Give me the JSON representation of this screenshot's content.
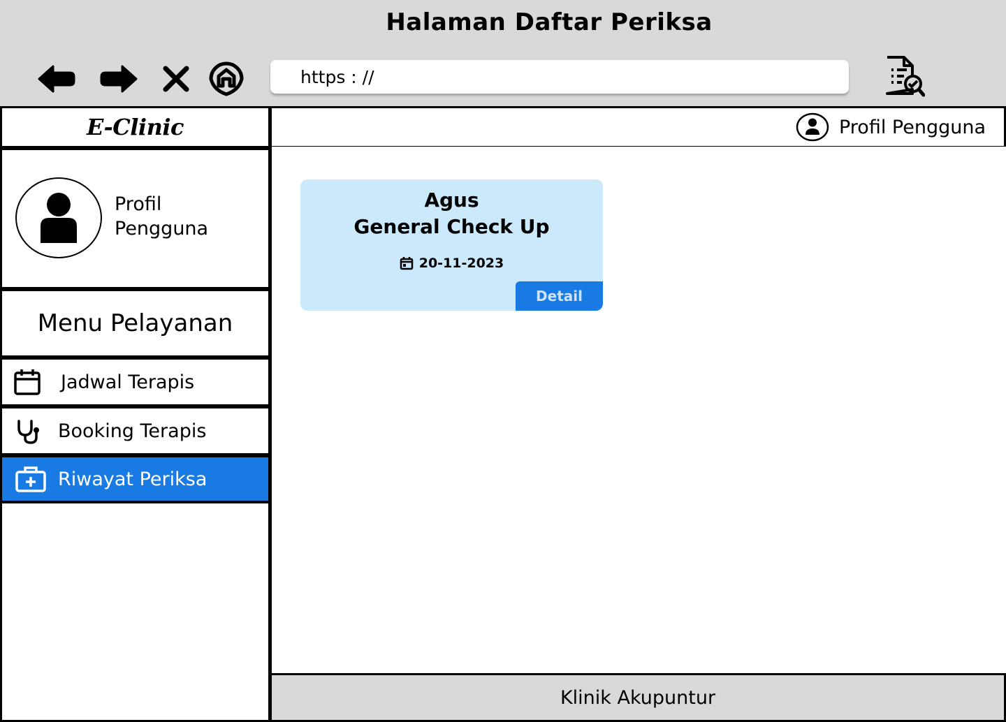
{
  "window": {
    "title": "Halaman Daftar Periksa"
  },
  "browser": {
    "url": "https : //",
    "icons": {
      "back": "arrow-left-icon",
      "forward": "arrow-right-icon",
      "close": "close-icon",
      "home": "home-icon",
      "report": "document-check-icon"
    }
  },
  "brand": {
    "name": "E-Clinic"
  },
  "header": {
    "profile_label": "Profil Pengguna",
    "profile_icon": "user-circle-icon"
  },
  "sidebar": {
    "profile_label": "Profil Pengguna",
    "menu_title": "Menu Pelayanan",
    "items": [
      {
        "label": "Jadwal Terapis",
        "icon": "calendar-icon",
        "active": false
      },
      {
        "label": "Booking Terapis",
        "icon": "stethoscope-icon",
        "active": false
      },
      {
        "label": "Riwayat Periksa",
        "icon": "medical-kit-icon",
        "active": true
      }
    ]
  },
  "records": [
    {
      "patient": "Agus",
      "service": "General Check Up",
      "date": "20-11-2023",
      "action_label": "Detail"
    }
  ],
  "footer": {
    "text": "Klinik Akupuntur"
  },
  "colors": {
    "accent": "#1a7ae3",
    "card_bg": "#cce9fb",
    "chrome_bg": "#d9d9d9"
  }
}
